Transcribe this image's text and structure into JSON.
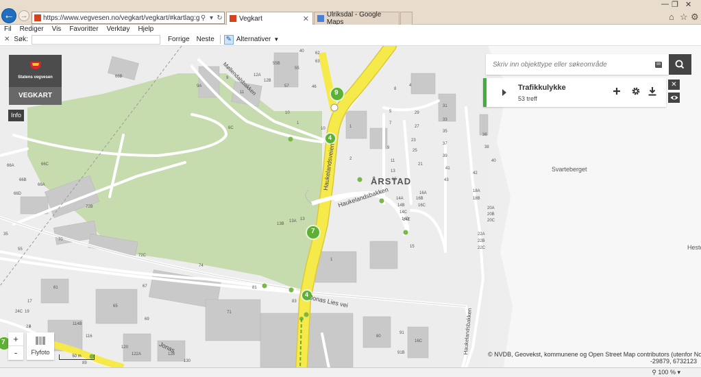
{
  "browser": {
    "url": "https://www.vegvesen.no/vegkart/vegkart/#kartlag:geodata/hva:(~(i",
    "tabs": [
      {
        "label": "Vegkart",
        "active": true
      },
      {
        "label": "Ulriksdal - Google Maps",
        "active": false
      }
    ],
    "menu": [
      "Fil",
      "Rediger",
      "Vis",
      "Favoritter",
      "Verktøy",
      "Hjelp"
    ],
    "find": {
      "label": "Søk:",
      "value": "",
      "prev": "Forrige",
      "next": "Neste",
      "options": "Alternativer"
    },
    "zoom": "100 %"
  },
  "app": {
    "brand_name": "Statens vegvesen",
    "app_title": "VEGKART",
    "info_label": "Info",
    "search_placeholder": "Skriv inn objekttype eller søkeområde",
    "layer": {
      "title": "Trafikkulykke",
      "count": "53 treff"
    },
    "zoom_in": "+",
    "zoom_out": "-",
    "flyfoto_label": "Flyfoto",
    "scale_label": "50 m",
    "attribution": "© NVDB, Geovekst, kommunene og Open Street Map contributors (utenfor Norge)",
    "coordinates": "-29879, 6732123"
  },
  "map": {
    "place_labels": [
      "ÅRSTAD",
      "Svarteberget",
      "Heste"
    ],
    "street_labels": [
      "Haukelandsbakken",
      "Haukelandsveien",
      "Møllendalsbakken",
      "Jonas Lies vei",
      "Haukelandsbakken",
      "Jonas"
    ],
    "clusters": [
      "9",
      "4",
      "7",
      "4",
      "7"
    ],
    "address_numbers": [
      "66B",
      "55B",
      "40",
      "62",
      "63",
      "55",
      "57",
      "46",
      "12A",
      "12B",
      "11",
      "10",
      "9A",
      "9",
      "1",
      "1",
      "2",
      "8",
      "4",
      "6C",
      "10",
      "5",
      "7",
      "9",
      "11",
      "13",
      "15",
      "21",
      "23",
      "25",
      "27",
      "29",
      "31",
      "33",
      "35",
      "37",
      "39",
      "41",
      "43",
      "36",
      "38",
      "40",
      "42",
      "14A",
      "14B",
      "14C",
      "14D",
      "14E",
      "16A",
      "16B",
      "16C",
      "18A",
      "18B",
      "20A",
      "20B",
      "20C",
      "22A",
      "22B",
      "22C",
      "13",
      "13A",
      "13B",
      "15",
      "66C",
      "66A",
      "66D",
      "66B",
      "66A",
      "72B",
      "70",
      "72C",
      "74",
      "55",
      "61",
      "67",
      "65",
      "69",
      "71",
      "81",
      "83",
      "91",
      "91B",
      "80",
      "16C",
      "114B",
      "116",
      "120",
      "122A",
      "128",
      "130",
      "17",
      "19",
      "21",
      "24C",
      "1",
      "35",
      "4",
      "12",
      "89"
    ]
  },
  "colors": {
    "main_road": "#f6e94a",
    "cluster": "#5cb034",
    "panel_accent": "#3db23a",
    "park": "#c7dcae",
    "building": "#c7c7c7"
  }
}
